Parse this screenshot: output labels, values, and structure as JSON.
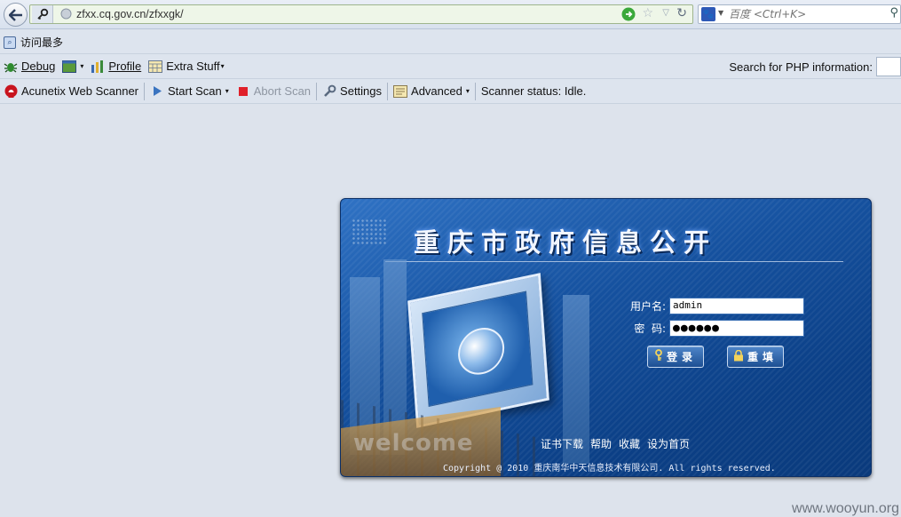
{
  "browser": {
    "url": "zfxx.cq.gov.cn/zfxxgk/",
    "search_placeholder": "百度 <Ctrl+K>",
    "bookmarks": [
      {
        "label": "访问最多"
      }
    ]
  },
  "toolbar_dev": {
    "debug": "Debug",
    "profile": "Profile",
    "extra_stuff": "Extra Stuff",
    "php_search_label": "Search for PHP information:"
  },
  "toolbar_scanner": {
    "brand": "Acunetix Web Scanner",
    "start_scan": "Start Scan",
    "abort_scan": "Abort Scan",
    "settings": "Settings",
    "advanced": "Advanced",
    "status": "Scanner status: Idle."
  },
  "login": {
    "title": "重庆市政府信息公开",
    "welcome": "welcome",
    "username_label": "用户名:",
    "username_value": "admin",
    "password_label": "密  码:",
    "password_value": "●●●●●●",
    "login_button": "登录",
    "reset_button": "重填",
    "links": [
      "证书下载",
      "帮助",
      "收藏",
      "设为首页"
    ],
    "copyright": "Copyright @ 2010 重庆南华中天信息技术有限公司. All rights reserved."
  },
  "watermark": "www.wooyun.org",
  "colors": {
    "panel_blue": "#15519f",
    "url_bar_bg": "#eef6e8",
    "stop_red": "#e0202a"
  }
}
